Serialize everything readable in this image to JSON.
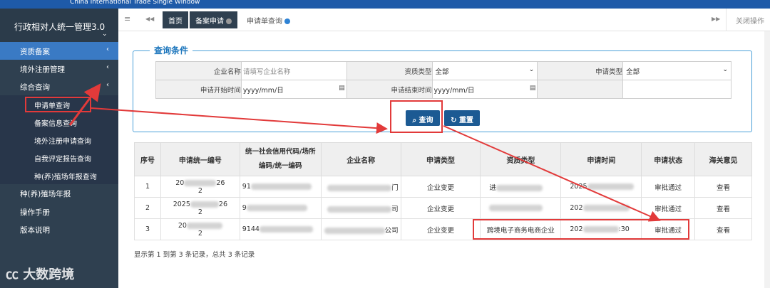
{
  "header": {
    "brand": "China International Trade Single Window"
  },
  "sidebar": {
    "title": "行政相对人统一管理3.0",
    "items": [
      {
        "label": "资质备案"
      },
      {
        "label": "境外注册管理"
      },
      {
        "label": "综合查询"
      }
    ],
    "subitems": [
      {
        "label": "申请单查询"
      },
      {
        "label": "备案信息查询"
      },
      {
        "label": "境外注册申请查询"
      },
      {
        "label": "自我评定报告查询"
      },
      {
        "label": "种(养)殖场年报查询"
      }
    ],
    "bottom_items": [
      {
        "label": "种(养)殖场年报"
      },
      {
        "label": "操作手册"
      },
      {
        "label": "版本说明"
      }
    ]
  },
  "tabs": {
    "menu_icon": "≡",
    "back_icon": "◀◀",
    "forward_icon": "▶▶",
    "items": [
      {
        "label": "首页"
      },
      {
        "label": "备案申请"
      },
      {
        "label": "申请单查询"
      }
    ],
    "close_ops": "关闭操作"
  },
  "query": {
    "legend": "查询条件",
    "company_name_label": "企业名称",
    "company_name_placeholder": "请填写企业名称",
    "qual_type_label": "资质类型",
    "qual_type_value": "全部",
    "apply_type_label": "申请类型",
    "apply_type_value": "全部",
    "start_time_label": "申请开始时间",
    "start_time_placeholder": "yyyy/mm/日",
    "end_time_label": "申请结束时间",
    "end_time_placeholder": "yyyy/mm/日",
    "search_button": "查询",
    "reset_button": "重置"
  },
  "table": {
    "headers": [
      "序号",
      "申请统一编号",
      "统一社会信用代码/场所编码/统一编码",
      "企业名称",
      "申请类型",
      "资质类型",
      "申请时间",
      "申请状态",
      "海关意见"
    ],
    "rows": [
      {
        "index": "1",
        "apply_no_a": "20",
        "apply_no_b": "26",
        "apply_no_c": "2",
        "credit_code": "91",
        "company_tail": "门",
        "apply_type": "企业变更",
        "qual_type": "进",
        "apply_time": "2025",
        "status": "审批通过",
        "opinion": "查看"
      },
      {
        "index": "2",
        "apply_no_a": "2025",
        "apply_no_b": "26",
        "apply_no_c": "2",
        "credit_code": "9",
        "company_tail": "司",
        "apply_type": "企业变更",
        "qual_type": "",
        "apply_time": "202",
        "status": "审批通过",
        "opinion": "查看"
      },
      {
        "index": "3",
        "apply_no_a": "20",
        "apply_no_b": "",
        "apply_no_c": "2",
        "credit_code": "9144",
        "company_tail": "公司",
        "apply_type": "企业变更",
        "qual_type": "跨境电子商务电商企业",
        "apply_time": "202",
        "apply_time_tail": ":30",
        "status": "审批通过",
        "opinion": "查看"
      }
    ]
  },
  "footer": {
    "summary": "显示第 1 到第 3 条记录，总共 3 条记录"
  },
  "watermark": "大数跨境",
  "colors": {
    "sidebar": "#2f4050",
    "accent": "#1c5a93",
    "annotation": "#e23a3a"
  }
}
